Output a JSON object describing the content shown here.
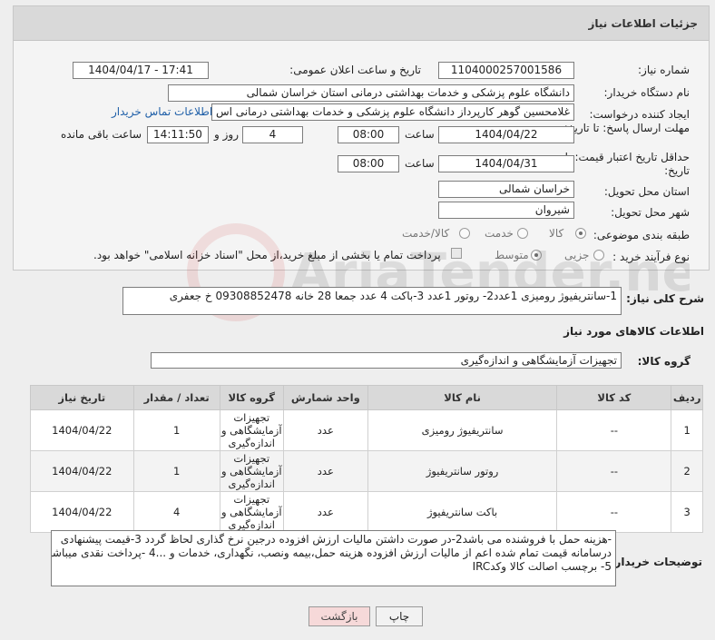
{
  "header": {
    "title": "جزئیات اطلاعات نیاز"
  },
  "fields": {
    "need_number_label": "شماره نیاز:",
    "need_number": "1104000257001586",
    "announce_label": "تاریخ و ساعت اعلان عمومی:",
    "announce_value": "1404/04/17 - 17:41",
    "buyer_org_label": "نام دستگاه خریدار:",
    "buyer_org": "دانشگاه علوم پزشکی و خدمات بهداشتی درمانی استان خراسان شمالی",
    "creator_label": "ایجاد کننده درخواست:",
    "creator": "غلامحسین گوهر کارپرداز  دانشگاه علوم پزشکی و خدمات بهداشتی درمانی اس",
    "contact_link": "اطلاعات تماس خریدار",
    "send_deadline_label": "مهلت ارسال پاسخ: تا تاریخ:",
    "send_date": "1404/04/22",
    "time_label": "ساعت",
    "send_time": "08:00",
    "days": "4",
    "days_and_label": "روز و",
    "remaining_time": "14:11:50",
    "remaining_label": "ساعت باقی مانده",
    "price_validity_label": "حداقل تاریخ اعتبار قیمت: تا تاریخ:",
    "price_date": "1404/04/31",
    "price_time": "08:00",
    "province_label": "استان محل تحویل:",
    "province": "خراسان شمالی",
    "city_label": "شهر محل تحویل:",
    "city": "شیروان",
    "category_label": "طبقه بندی موضوعی:",
    "category_options": [
      "کالا",
      "خدمت",
      "کالا/خدمت"
    ],
    "process_label": "نوع فرآیند خرید :",
    "process_options": [
      "جزیی",
      "متوسط"
    ],
    "payment_note": "پرداخت تمام یا بخشی از مبلغ خرید،از محل \"اسناد خزانه اسلامی\" خواهد بود."
  },
  "description": {
    "label": "شرح کلی نیاز:",
    "text": "1-سانتریفیوژ رومیزی 1عدد2- روتور 1عدد 3-باکت 4 عدد جمعا 28 خانه 09308852478 خ جعفری"
  },
  "goods_section": {
    "title": "اطلاعات کالاهای مورد نیاز",
    "group_label": "گروه کالا:",
    "group_value": "تجهیزات آزمایشگاهی و اندازه‌گیری"
  },
  "table": {
    "headers": [
      "ردیف",
      "کد کالا",
      "نام کالا",
      "واحد شمارش",
      "گروه کالا",
      "تعداد / مقدار",
      "تاریخ نیاز"
    ],
    "rows": [
      [
        "1",
        "--",
        "سانتریفیوژ رومیزی",
        "عدد",
        "تجهیزات آزمایشگاهی و اندازه‌گیری",
        "1",
        "1404/04/22"
      ],
      [
        "2",
        "--",
        "روتور سانتریفیوژ",
        "عدد",
        "تجهیزات آزمایشگاهی و اندازه‌گیری",
        "1",
        "1404/04/22"
      ],
      [
        "3",
        "--",
        "باکت سانتریفیوژ",
        "عدد",
        "تجهیزات آزمایشگاهی و اندازه‌گیری",
        "4",
        "1404/04/22"
      ]
    ]
  },
  "notes": {
    "label": "توضیحات خریدار:",
    "line1": "-هزینه حمل با فروشنده می باشد2-در صورت داشتن مالیات ارزش افزوده درجین نرخ گذاری لحاظ گردد 3-قیمت پیشنهادی",
    "line2": "درسامانه  قیمت تمام شده اعم از مالیات ارزش افزوده هزینه حمل،بیمه ونصب، نگهداری، خدمات و ...4 -پرداخت نقدی میباشد",
    "line3": "5- برچسب اصالت کالا وکدIRC"
  },
  "buttons": {
    "print": "چاپ",
    "back": "بازگشت"
  },
  "watermark": {
    "text": "AriaTender.net"
  }
}
